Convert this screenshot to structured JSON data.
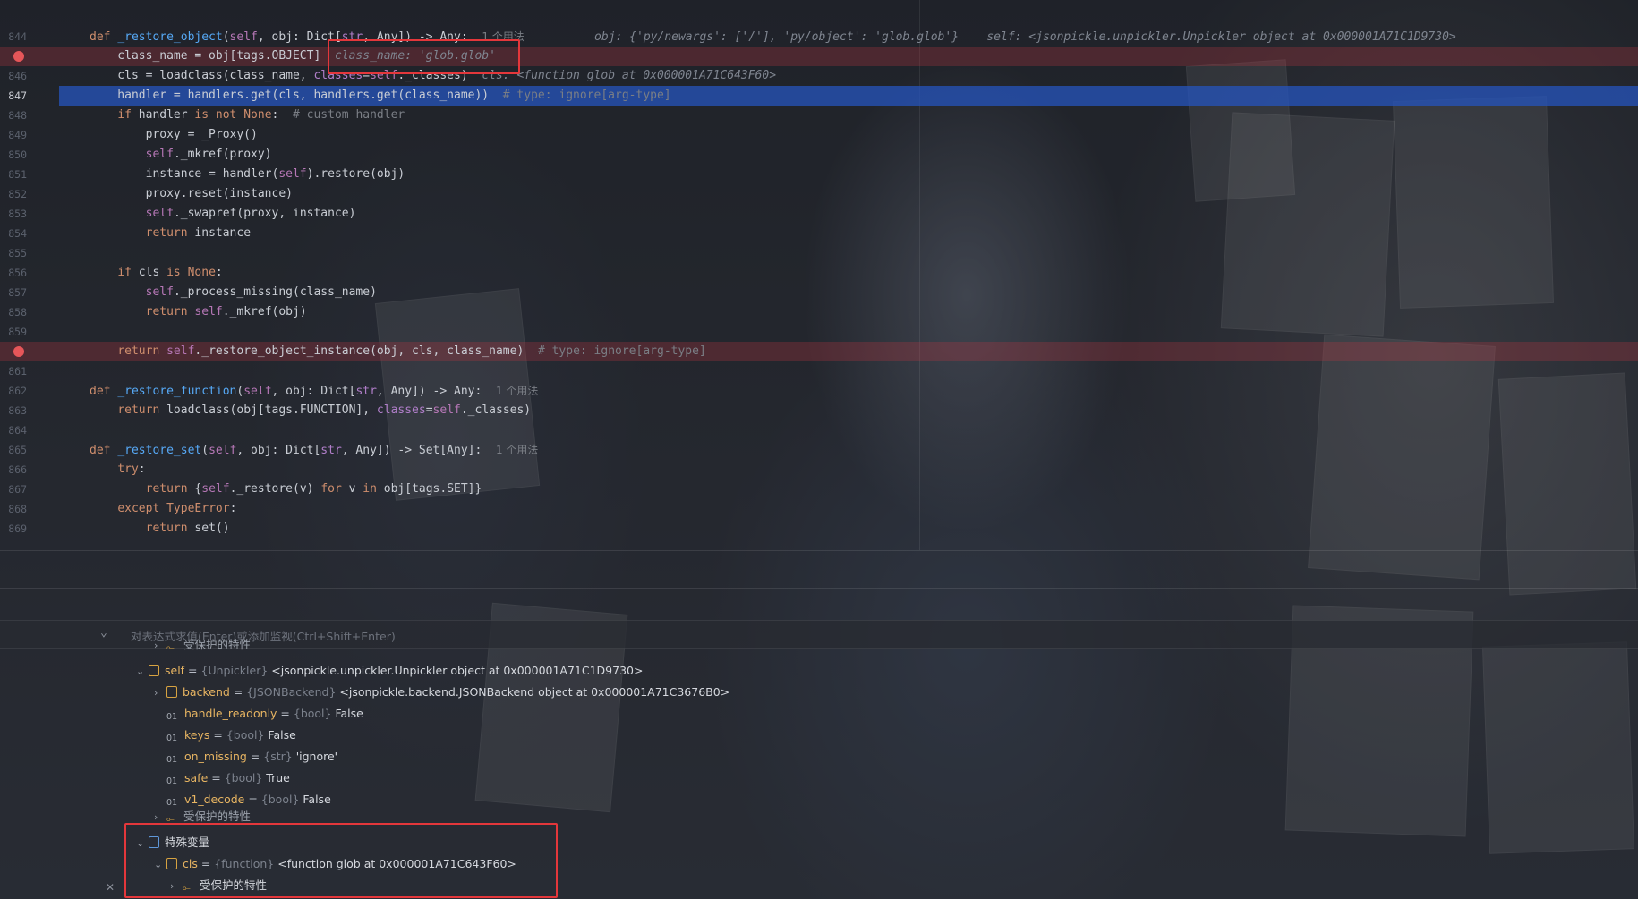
{
  "editor": {
    "lines": [
      {
        "num": "844",
        "type": "normal",
        "breakpoint": false,
        "segments": [
          [
            "kw",
            "def "
          ],
          [
            "fn",
            "_restore_object"
          ],
          [
            "",
            "("
          ],
          [
            "self",
            "self"
          ],
          [
            "",
            ", obj: Dict["
          ],
          [
            "param",
            "str"
          ],
          [
            "",
            ", Any]) -> Any:  "
          ],
          [
            "usage",
            "1 个用法"
          ],
          [
            "",
            ""
          ],
          [
            "hint",
            "          obj: {'py/newargs': ['/'], 'py/object': 'glob.glob'}    self: <jsonpickle.unpickler.Unpickler object at 0x000001A71C1D9730>"
          ]
        ]
      },
      {
        "num": "",
        "type": "bp",
        "breakpoint": true,
        "segments": [
          [
            "",
            "    class_name = obj[tags.OBJECT]  "
          ],
          [
            "hint",
            "class_name: 'glob.glob'"
          ]
        ]
      },
      {
        "num": "846",
        "type": "normal",
        "breakpoint": false,
        "segments": [
          [
            "",
            "    cls = loadclass(class_name, "
          ],
          [
            "param",
            "classes"
          ],
          [
            "",
            "="
          ],
          [
            "self",
            "self"
          ],
          [
            "",
            "._classes)  "
          ],
          [
            "hint",
            "cls: <function glob at 0x000001A71C643F60>"
          ]
        ]
      },
      {
        "num": "847",
        "type": "cur",
        "breakpoint": false,
        "segments": [
          [
            "",
            "    handler = handlers.get(cls, handlers.get(class_name))  "
          ],
          [
            "cm",
            "# type: ignore[arg-type]"
          ]
        ]
      },
      {
        "num": "848",
        "type": "normal",
        "breakpoint": false,
        "segments": [
          [
            "",
            "    "
          ],
          [
            "kw",
            "if"
          ],
          [
            "",
            " handler "
          ],
          [
            "kw",
            "is not None"
          ],
          [
            "",
            ":  "
          ],
          [
            "cm",
            "# custom handler"
          ]
        ]
      },
      {
        "num": "849",
        "type": "normal",
        "breakpoint": false,
        "segments": [
          [
            "",
            "        proxy = _Proxy()"
          ]
        ]
      },
      {
        "num": "850",
        "type": "normal",
        "breakpoint": false,
        "segments": [
          [
            "",
            "        "
          ],
          [
            "self",
            "self"
          ],
          [
            "",
            "._mkref(proxy)"
          ]
        ]
      },
      {
        "num": "851",
        "type": "normal",
        "breakpoint": false,
        "segments": [
          [
            "",
            "        instance = handler("
          ],
          [
            "self",
            "self"
          ],
          [
            "",
            ").restore(obj)"
          ]
        ]
      },
      {
        "num": "852",
        "type": "normal",
        "breakpoint": false,
        "segments": [
          [
            "",
            "        proxy.reset(instance)"
          ]
        ]
      },
      {
        "num": "853",
        "type": "normal",
        "breakpoint": false,
        "segments": [
          [
            "",
            "        "
          ],
          [
            "self",
            "self"
          ],
          [
            "",
            "._swapref(proxy, instance)"
          ]
        ]
      },
      {
        "num": "854",
        "type": "normal",
        "breakpoint": false,
        "segments": [
          [
            "",
            "        "
          ],
          [
            "kw",
            "return"
          ],
          [
            "",
            " instance"
          ]
        ]
      },
      {
        "num": "855",
        "type": "normal",
        "breakpoint": false,
        "segments": [
          [
            "",
            ""
          ]
        ]
      },
      {
        "num": "856",
        "type": "normal",
        "breakpoint": false,
        "segments": [
          [
            "",
            "    "
          ],
          [
            "kw",
            "if"
          ],
          [
            "",
            " cls "
          ],
          [
            "kw",
            "is None"
          ],
          [
            "",
            ":"
          ]
        ]
      },
      {
        "num": "857",
        "type": "normal",
        "breakpoint": false,
        "segments": [
          [
            "",
            "        "
          ],
          [
            "self",
            "self"
          ],
          [
            "",
            "._process_missing(class_name)"
          ]
        ]
      },
      {
        "num": "858",
        "type": "normal",
        "breakpoint": false,
        "segments": [
          [
            "",
            "        "
          ],
          [
            "kw",
            "return "
          ],
          [
            "self",
            "self"
          ],
          [
            "",
            "._mkref(obj)"
          ]
        ]
      },
      {
        "num": "859",
        "type": "normal",
        "breakpoint": false,
        "segments": [
          [
            "",
            ""
          ]
        ]
      },
      {
        "num": "",
        "type": "bp",
        "breakpoint": true,
        "segments": [
          [
            "",
            "    "
          ],
          [
            "kw",
            "return "
          ],
          [
            "self",
            "self"
          ],
          [
            "",
            "._restore_object_instance(obj, cls, class_name)  "
          ],
          [
            "cm",
            "# type: ignore[arg-type]"
          ]
        ]
      },
      {
        "num": "861",
        "type": "normal",
        "breakpoint": false,
        "segments": [
          [
            "",
            ""
          ]
        ]
      },
      {
        "num": "862",
        "type": "normal",
        "breakpoint": false,
        "segments": [
          [
            "kw",
            "def "
          ],
          [
            "fn",
            "_restore_function"
          ],
          [
            "",
            "("
          ],
          [
            "self",
            "self"
          ],
          [
            "",
            ", obj: Dict["
          ],
          [
            "param",
            "str"
          ],
          [
            "",
            ", Any]) -> Any:  "
          ],
          [
            "usage",
            "1 个用法"
          ]
        ]
      },
      {
        "num": "863",
        "type": "normal",
        "breakpoint": false,
        "segments": [
          [
            "",
            "    "
          ],
          [
            "kw",
            "return"
          ],
          [
            "",
            " loadclass(obj[tags.FUNCTION], "
          ],
          [
            "param",
            "classes"
          ],
          [
            "",
            "="
          ],
          [
            "self",
            "self"
          ],
          [
            "",
            "._classes)"
          ]
        ]
      },
      {
        "num": "864",
        "type": "normal",
        "breakpoint": false,
        "segments": [
          [
            "",
            ""
          ]
        ]
      },
      {
        "num": "865",
        "type": "normal",
        "breakpoint": false,
        "segments": [
          [
            "kw",
            "def "
          ],
          [
            "fn",
            "_restore_set"
          ],
          [
            "",
            "("
          ],
          [
            "self",
            "self"
          ],
          [
            "",
            ", obj: Dict["
          ],
          [
            "param",
            "str"
          ],
          [
            "",
            ", Any]) -> Set[Any]:  "
          ],
          [
            "usage",
            "1 个用法"
          ]
        ]
      },
      {
        "num": "866",
        "type": "normal",
        "breakpoint": false,
        "segments": [
          [
            "",
            "    "
          ],
          [
            "kw",
            "try"
          ],
          [
            "",
            ":"
          ]
        ]
      },
      {
        "num": "867",
        "type": "normal",
        "breakpoint": false,
        "segments": [
          [
            "",
            "        "
          ],
          [
            "kw",
            "return"
          ],
          [
            "",
            " {"
          ],
          [
            "self",
            "self"
          ],
          [
            "",
            "._restore(v) "
          ],
          [
            "kw",
            "for"
          ],
          [
            "",
            " v "
          ],
          [
            "kw",
            "in"
          ],
          [
            "",
            " obj[tags.SET]}"
          ]
        ]
      },
      {
        "num": "868",
        "type": "normal",
        "breakpoint": false,
        "segments": [
          [
            "",
            "    "
          ],
          [
            "kw",
            "except"
          ],
          [
            "",
            " "
          ],
          [
            "kw",
            "TypeError"
          ],
          [
            "",
            ":"
          ]
        ]
      },
      {
        "num": "869",
        "type": "normal",
        "breakpoint": false,
        "segments": [
          [
            "",
            "        "
          ],
          [
            "kw",
            "return"
          ],
          [
            "",
            " set()"
          ]
        ]
      }
    ]
  },
  "eval": {
    "placeholder": "对表达式求值(Enter)或添加监视(Ctrl+Shift+Enter)"
  },
  "variables": {
    "top_partial": "受保护的特性",
    "self_row": {
      "name": "self",
      "eq": " = ",
      "type": "{Unpickler}",
      "value": " <jsonpickle.unpickler.Unpickler object at 0x000001A71C1D9730>"
    },
    "children": [
      {
        "kind": "obj",
        "expandable": true,
        "name": "backend",
        "type": "{JSONBackend}",
        "value": " <jsonpickle.backend.JSONBackend object at 0x000001A71C3676B0>"
      },
      {
        "kind": "prim",
        "expandable": false,
        "name": "handle_readonly",
        "type": "{bool}",
        "value": " False"
      },
      {
        "kind": "prim",
        "expandable": false,
        "name": "keys",
        "type": "{bool}",
        "value": " False"
      },
      {
        "kind": "prim",
        "expandable": false,
        "name": "on_missing",
        "type": "{str}",
        "value": " 'ignore'"
      },
      {
        "kind": "prim",
        "expandable": false,
        "name": "safe",
        "type": "{bool}",
        "value": " True"
      },
      {
        "kind": "prim",
        "expandable": false,
        "name": "v1_decode",
        "type": "{bool}",
        "value": " False"
      }
    ],
    "protected_label": "受保护的特性",
    "special_group": "特殊变量",
    "cls_row": {
      "name": "cls",
      "eq": " = ",
      "type": "{function}",
      "value": " <function glob at 0x000001A71C643F60>"
    },
    "cls_protected": "受保护的特性"
  },
  "icons": {
    "breakpoint": "#e65659",
    "highlight_box": "#e4373b",
    "current_line": "#2654be"
  }
}
